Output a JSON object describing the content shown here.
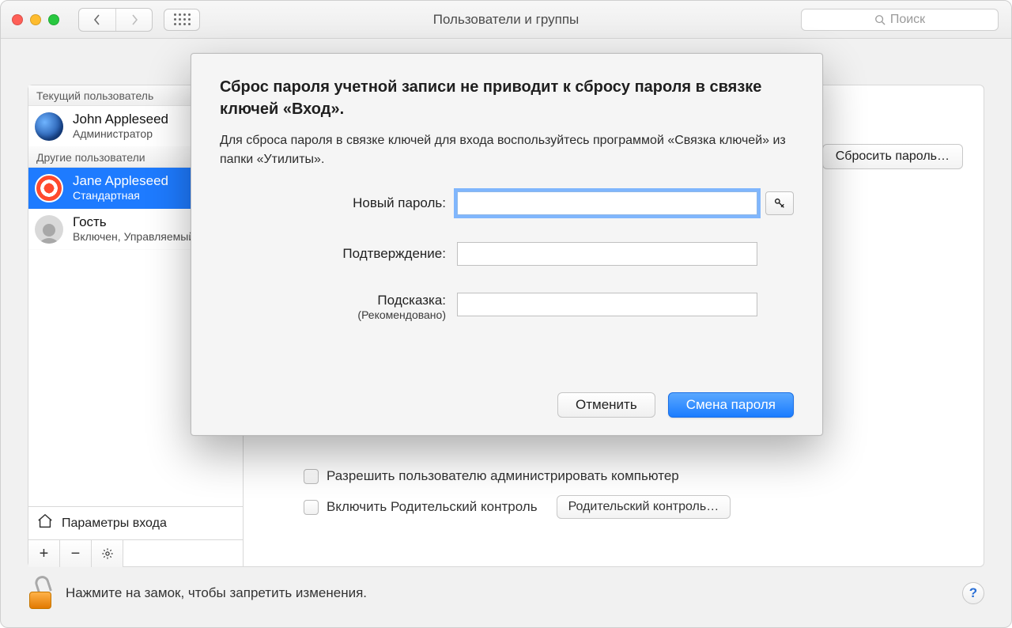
{
  "titlebar": {
    "window_title": "Пользователи и группы",
    "search_placeholder": "Поиск"
  },
  "sidebar": {
    "current_user_section": "Текущий пользователь",
    "other_users_section": "Другие пользователи",
    "login_options_label": "Параметры входа",
    "users": [
      {
        "name": "John Appleseed",
        "role": "Администратор",
        "selected": false
      },
      {
        "name": "Jane Appleseed",
        "role": "Стандартная",
        "selected": true
      },
      {
        "name": "Гость",
        "role": "Включен, Управляемый",
        "selected": false
      }
    ]
  },
  "detail": {
    "reset_password_button": "Сбросить пароль…",
    "allow_admin_label": "Разрешить пользователю администрировать компьютер",
    "enable_parental_label": "Включить Родительский контроль",
    "open_parental_button": "Родительский контроль…"
  },
  "footer": {
    "lock_hint": "Нажмите на замок, чтобы запретить изменения.",
    "help_label": "?"
  },
  "sheet": {
    "heading": "Сброс пароля учетной записи не приводит к сбросу пароля в связке ключей «Вход».",
    "info": "Для сброса пароля в связке ключей для входа воспользуйтесь программой «Связка ключей» из папки «Утилиты».",
    "new_password_label": "Новый пароль:",
    "confirm_label": "Подтверждение:",
    "hint_label": "Подсказка:",
    "hint_sub": "(Рекомендовано)",
    "cancel_button": "Отменить",
    "confirm_button": "Смена пароля"
  }
}
